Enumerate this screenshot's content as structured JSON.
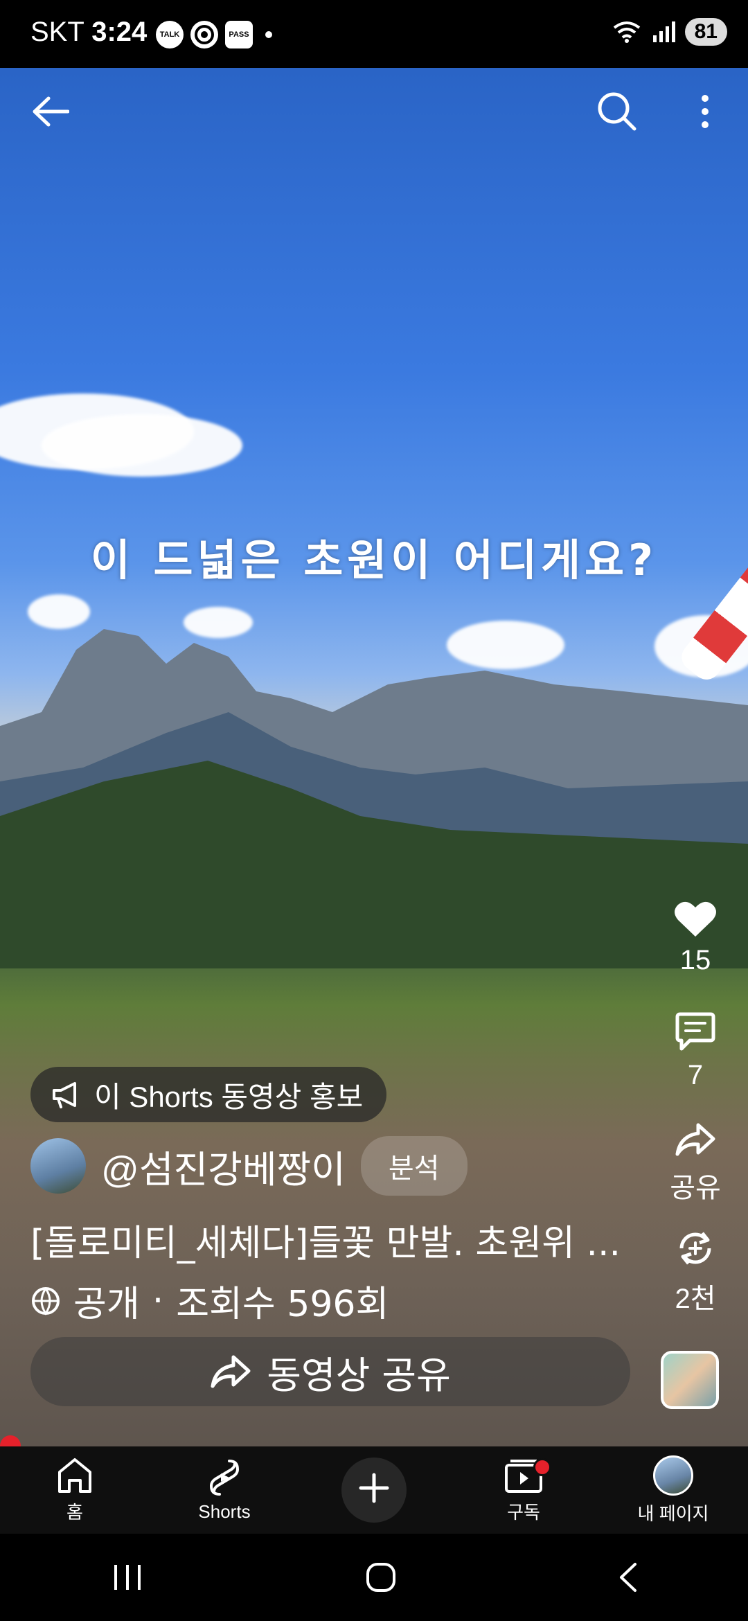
{
  "status_bar": {
    "carrier": "SKT",
    "time": "3:24",
    "icons": [
      "talk-icon",
      "chrome-icon",
      "pass-icon"
    ],
    "icon_labels": [
      "TALK",
      "",
      "PASS"
    ],
    "battery": "81"
  },
  "video": {
    "overlay_text": "이 드넓은 초원이 어디게요?"
  },
  "actions": {
    "like_count": "15",
    "comment_count": "7",
    "share_label": "공유",
    "remix_label": "2천"
  },
  "promo": {
    "label": "이 Shorts 동영상 홍보"
  },
  "channel": {
    "handle": "@섬진강베짱이",
    "analysis_label": "분석"
  },
  "description": "[돌로미티_세체다]들꽃 만발. 초원위 ...",
  "meta": {
    "visibility": "공개",
    "separator": "·",
    "views": "조회수 596회"
  },
  "share_bar": {
    "label": "동영상 공유"
  },
  "bottom_nav": {
    "home": "홈",
    "shorts": "Shorts",
    "subscriptions": "구독",
    "my_page": "내 페이지"
  },
  "colors": {
    "accent_red": "#e5212b",
    "nav_bg": "#0f0f0f"
  }
}
